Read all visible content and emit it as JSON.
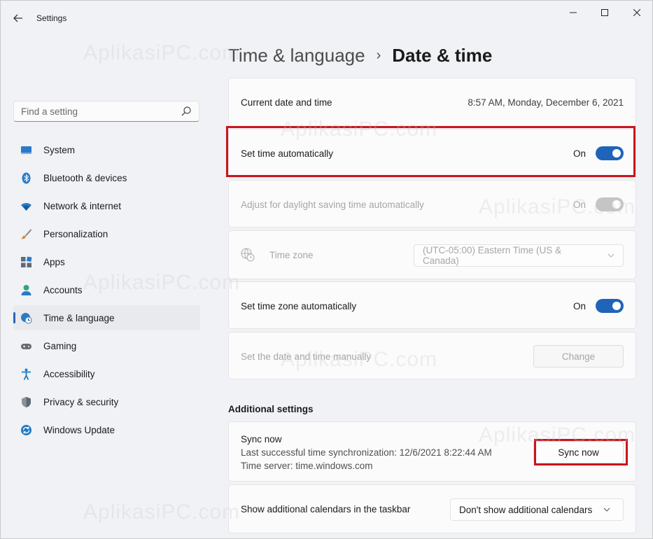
{
  "window": {
    "app_title": "Settings",
    "controls": {
      "minimize": "minimize",
      "maximize": "maximize",
      "close": "close"
    }
  },
  "search": {
    "placeholder": "Find a setting"
  },
  "sidebar": {
    "items": [
      {
        "label": "System",
        "icon": "monitor-icon",
        "color": "#2a7ac9"
      },
      {
        "label": "Bluetooth & devices",
        "icon": "bluetooth-icon",
        "color": "#2a7ac9"
      },
      {
        "label": "Network & internet",
        "icon": "wifi-icon",
        "color": "#2a7ac9"
      },
      {
        "label": "Personalization",
        "icon": "brush-icon",
        "color": "#c77d33"
      },
      {
        "label": "Apps",
        "icon": "apps-icon",
        "color": "#5f6b7a"
      },
      {
        "label": "Accounts",
        "icon": "person-icon",
        "color": "#2ea77b"
      },
      {
        "label": "Time & language",
        "icon": "globe-clock-icon",
        "color": "#2a7ac9",
        "active": true
      },
      {
        "label": "Gaming",
        "icon": "gamepad-icon",
        "color": "#6b6b6b"
      },
      {
        "label": "Accessibility",
        "icon": "accessibility-icon",
        "color": "#1f7bc4"
      },
      {
        "label": "Privacy & security",
        "icon": "shield-icon",
        "color": "#6b7480"
      },
      {
        "label": "Windows Update",
        "icon": "update-icon",
        "color": "#1f7bc4"
      }
    ]
  },
  "breadcrumb": {
    "parent": "Time & language",
    "separator": "›",
    "current": "Date & time"
  },
  "settings": {
    "current": {
      "label": "Current date and time",
      "value": "8:57 AM, Monday, December 6, 2021"
    },
    "auto_time": {
      "label": "Set time automatically",
      "state": "On"
    },
    "dst": {
      "label": "Adjust for daylight saving time automatically",
      "state": "On"
    },
    "timezone": {
      "label": "Time zone",
      "value": "(UTC-05:00) Eastern Time (US & Canada)"
    },
    "auto_tz": {
      "label": "Set time zone automatically",
      "state": "On"
    },
    "manual": {
      "label": "Set the date and time manually",
      "button": "Change"
    }
  },
  "additional": {
    "title": "Additional settings",
    "sync": {
      "title": "Sync now",
      "last_sync": "Last successful time synchronization: 12/6/2021 8:22:44 AM",
      "server": "Time server: time.windows.com",
      "button": "Sync now"
    },
    "calendars": {
      "label": "Show additional calendars in the taskbar",
      "value": "Don't show additional calendars"
    }
  },
  "watermark": {
    "text": "AplikasiPC.com"
  },
  "colors": {
    "accent": "#1f64b8",
    "highlight": "#c8161d"
  }
}
